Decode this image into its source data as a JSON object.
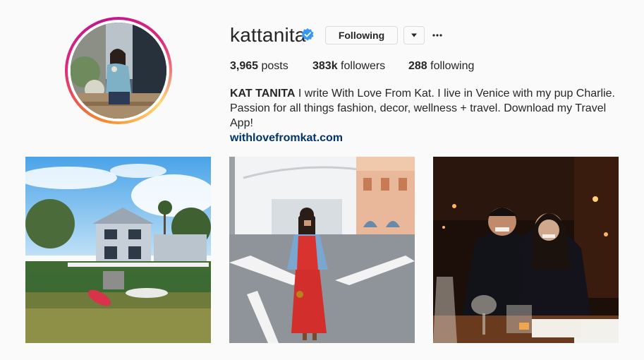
{
  "profile": {
    "username": "kattanita",
    "verified": true,
    "follow_button_label": "Following",
    "dropdown_icon": "caret-down-icon",
    "more_icon": "ellipsis-icon",
    "avatar_icon": "profile-photo"
  },
  "stats": {
    "posts_count": "3,965",
    "posts_label": " posts",
    "followers_count": "383k",
    "followers_label": " followers",
    "following_count": "288",
    "following_label": " following"
  },
  "bio": {
    "name": "KAT TANITA",
    "text_line1": " I write With Love From Kat. I live in Venice with my pup Charlie.",
    "text_line2": "Passion for all things fashion, decor, wellness + travel. Download my Travel App!",
    "link": "withlovefromkat.com"
  },
  "colors": {
    "link": "#003569",
    "verified_badge": "#3897f0",
    "border": "#dbdbdb",
    "background": "#fafafa"
  }
}
